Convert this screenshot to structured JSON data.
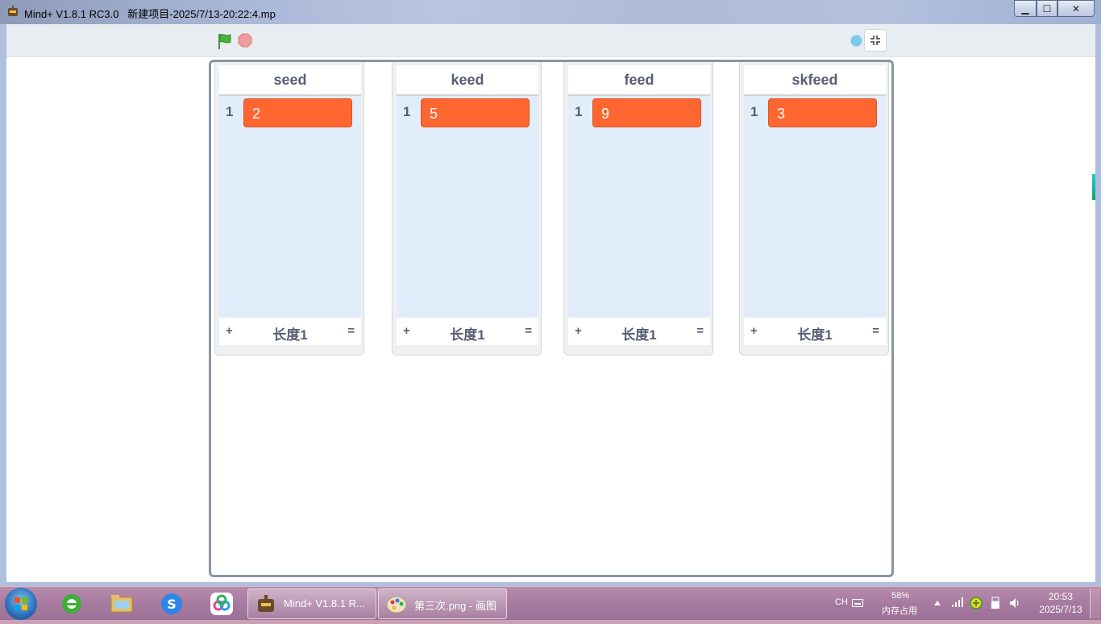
{
  "window": {
    "title": "Mind+ V1.8.1 RC3.0   新建项目-2025/7/13-20:22:4.mp",
    "min_glyph": "▁",
    "max_glyph": "☐",
    "close_glyph": "✕"
  },
  "toolbar": {
    "green_flag_icon": "green-flag-icon",
    "stop_icon": "stop-icon",
    "fullscreen_icon": "exit-fullscreen-icon"
  },
  "lists": [
    {
      "name": "seed",
      "items": [
        {
          "index": "1",
          "value": "2"
        }
      ],
      "add_label": "+",
      "length_label": "长度1",
      "resize_label": "="
    },
    {
      "name": "keed",
      "items": [
        {
          "index": "1",
          "value": "5"
        }
      ],
      "add_label": "+",
      "length_label": "长度1",
      "resize_label": "="
    },
    {
      "name": "feed",
      "items": [
        {
          "index": "1",
          "value": "9"
        }
      ],
      "add_label": "+",
      "length_label": "长度1",
      "resize_label": "="
    },
    {
      "name": "skfeed",
      "items": [
        {
          "index": "1",
          "value": "3"
        }
      ],
      "add_label": "+",
      "length_label": "长度1",
      "resize_label": "="
    }
  ],
  "colors": {
    "list_item": "#ff6630",
    "list_body": "#e1edfb",
    "list_text": "#575e75",
    "taskbar": "#a77ba0"
  },
  "taskbar": {
    "quick_launch": [
      "ie-icon",
      "file-explorer-icon",
      "sogou-input-icon",
      "app-icon"
    ],
    "buttons": [
      {
        "label": "Mind+ V1.8.1 R...",
        "icon": "mindplus-icon"
      },
      {
        "label": "第三次.png - 画图",
        "icon": "paint-icon"
      }
    ],
    "tray": {
      "ime": "CH",
      "memory_percent": "58%",
      "memory_label": "内存占用",
      "time": "20:53",
      "date": "2025/7/13"
    }
  }
}
